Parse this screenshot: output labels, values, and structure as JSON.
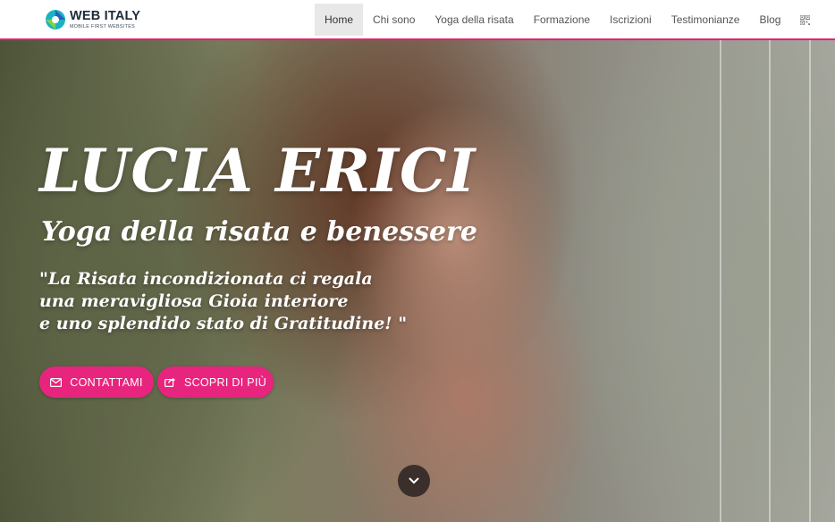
{
  "header": {
    "logo": {
      "title": "WEB ITALY",
      "subtitle": "MOBILE FIRST WEBSITES"
    },
    "nav": [
      {
        "label": "Home",
        "active": true
      },
      {
        "label": "Chi sono"
      },
      {
        "label": "Yoga della risata"
      },
      {
        "label": "Formazione"
      },
      {
        "label": "Iscrizioni"
      },
      {
        "label": "Testimonianze"
      },
      {
        "label": "Blog"
      }
    ],
    "qr_icon": "qr-code-icon",
    "accent_color": "#e91e78"
  },
  "hero": {
    "title": "LUCIA ERICI",
    "subtitle": "Yoga della risata e benessere",
    "quote_lines": [
      "\"La Risata incondizionata ci regala",
      "una meravigliosa Gioia interiore",
      "e uno splendido stato di Gratitudine! \""
    ],
    "buttons": {
      "contact": {
        "label": "CONTATTAMI",
        "icon": "envelope-icon"
      },
      "more": {
        "label": "SCOPRI DI PIÙ",
        "icon": "share-icon"
      }
    },
    "button_color": "#e7257e",
    "scroll_icon": "chevron-down-icon"
  }
}
